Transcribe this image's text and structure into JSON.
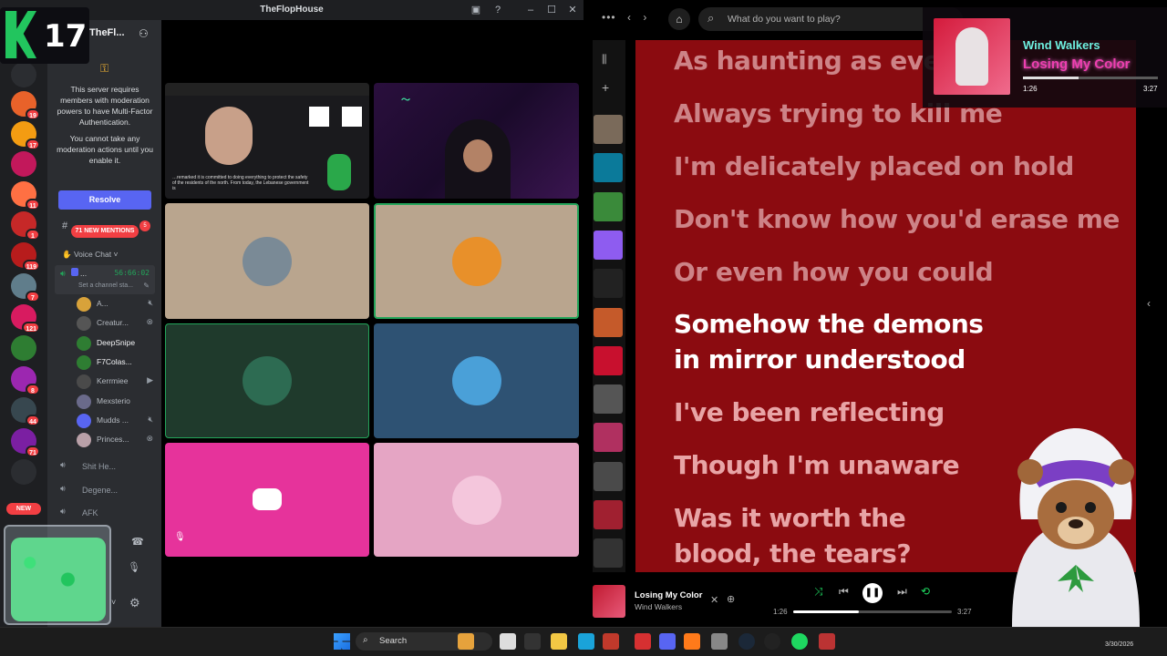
{
  "stream_badge": {
    "number": "17"
  },
  "discord": {
    "window_title": "TheFlopHouse",
    "server_name": "TheFl...",
    "mfa_notice": "This server requires members with moderation powers to have Multi-Factor Authentication.",
    "mfa_notice_2": "You cannot take any moderation actions until you enable it.",
    "resolve_label": "Resolve",
    "new_mentions": "71 NEW MENTIONS",
    "voice_category": "Voice Chat",
    "active_channel": {
      "name": "...",
      "timer": "56:66:02",
      "status_placeholder": "Set a channel sta..."
    },
    "members": [
      {
        "name": "A..."
      },
      {
        "name": "Creatur..."
      },
      {
        "name": "DeepSnipe"
      },
      {
        "name": "F7Colas..."
      },
      {
        "name": "Kerrmiee"
      },
      {
        "name": "Mexsterio"
      },
      {
        "name": "Mudds ..."
      },
      {
        "name": "Princes..."
      }
    ],
    "voice_channels": [
      {
        "name": "Shit He..."
      },
      {
        "name": "Degene..."
      },
      {
        "name": "AFK"
      }
    ],
    "guild_badges": [
      "19",
      "17",
      "11",
      "1",
      "119",
      "7",
      "121",
      "8",
      "44",
      "71"
    ],
    "new_label": "NEW",
    "stream_caption": "…remarked it is committed to doing everything to protect the safety of the residents of the north. From today, the Lebanese government is"
  },
  "spotify": {
    "search_placeholder": "What do you want to play?",
    "lyrics": [
      {
        "text": "As haunting as ever",
        "state": "past"
      },
      {
        "text": "Always trying to kill me",
        "state": "past"
      },
      {
        "text": "I'm delicately placed on hold",
        "state": "past"
      },
      {
        "text": "Don't know how you'd erase me",
        "state": "past"
      },
      {
        "text": "Or even how you could",
        "state": "past"
      },
      {
        "text": "Somehow the demons",
        "state": "active"
      },
      {
        "text": "in mirror understood",
        "state": "active"
      },
      {
        "text": "I've been reflecting",
        "state": "upcoming"
      },
      {
        "text": "Though I'm unaware",
        "state": "upcoming"
      },
      {
        "text": "Was it worth the",
        "state": "upcoming"
      },
      {
        "text": "blood, the tears?",
        "state": "upcoming"
      }
    ],
    "player": {
      "title": "Losing My Color",
      "artist": "Wind Walkers",
      "elapsed": "1:26",
      "duration": "3:27",
      "progress": 0.415
    }
  },
  "now_playing_overlay": {
    "artist": "Wind Walkers",
    "song": "Losing My Color",
    "elapsed": "1:26",
    "duration": "3:27",
    "progress": 0.415
  },
  "taskbar": {
    "search_label": "Search",
    "date": "3/30/2026"
  },
  "colors": {
    "lyrics_bg": "#8b0b10",
    "discord_blurple": "#5865f2",
    "accent_green": "#23a55a",
    "spotify_green": "#1ed760"
  }
}
